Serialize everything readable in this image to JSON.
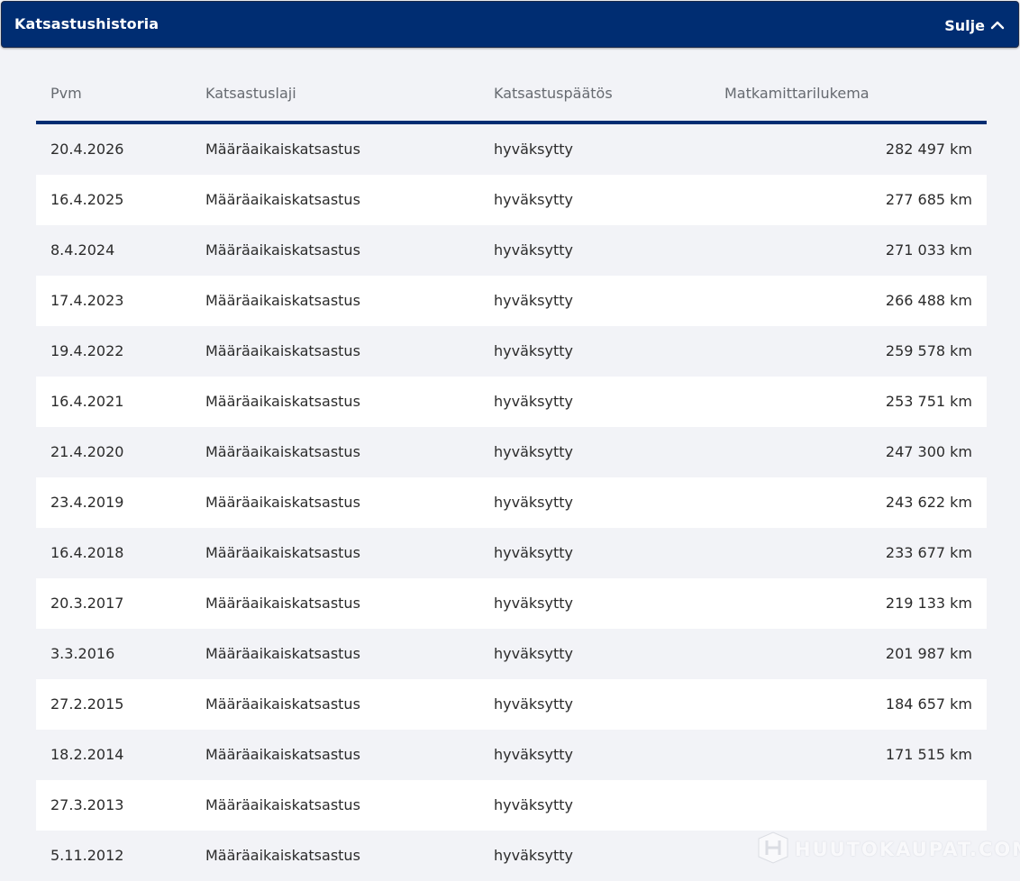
{
  "header": {
    "title": "Katsastushistoria",
    "close_label": "Sulje",
    "close_icon": "chevron-up-icon",
    "background": "#002d72"
  },
  "table": {
    "columns": [
      "Pvm",
      "Katsastuslaji",
      "Katsastuspäätös",
      "Matkamittarilukema"
    ],
    "rows": [
      {
        "date": "20.4.2026",
        "type": "Määräaikaiskatsastus",
        "decision": "hyväksytty",
        "odometer": "282 497 km"
      },
      {
        "date": "16.4.2025",
        "type": "Määräaikaiskatsastus",
        "decision": "hyväksytty",
        "odometer": "277 685 km"
      },
      {
        "date": "8.4.2024",
        "type": "Määräaikaiskatsastus",
        "decision": "hyväksytty",
        "odometer": "271 033 km"
      },
      {
        "date": "17.4.2023",
        "type": "Määräaikaiskatsastus",
        "decision": "hyväksytty",
        "odometer": "266 488 km"
      },
      {
        "date": "19.4.2022",
        "type": "Määräaikaiskatsastus",
        "decision": "hyväksytty",
        "odometer": "259 578 km"
      },
      {
        "date": "16.4.2021",
        "type": "Määräaikaiskatsastus",
        "decision": "hyväksytty",
        "odometer": "253 751 km"
      },
      {
        "date": "21.4.2020",
        "type": "Määräaikaiskatsastus",
        "decision": "hyväksytty",
        "odometer": "247 300 km"
      },
      {
        "date": "23.4.2019",
        "type": "Määräaikaiskatsastus",
        "decision": "hyväksytty",
        "odometer": "243 622 km"
      },
      {
        "date": "16.4.2018",
        "type": "Määräaikaiskatsastus",
        "decision": "hyväksytty",
        "odometer": "233 677 km"
      },
      {
        "date": "20.3.2017",
        "type": "Määräaikaiskatsastus",
        "decision": "hyväksytty",
        "odometer": "219 133 km"
      },
      {
        "date": "3.3.2016",
        "type": "Määräaikaiskatsastus",
        "decision": "hyväksytty",
        "odometer": "201 987 km"
      },
      {
        "date": "27.2.2015",
        "type": "Määräaikaiskatsastus",
        "decision": "hyväksytty",
        "odometer": "184 657 km"
      },
      {
        "date": "18.2.2014",
        "type": "Määräaikaiskatsastus",
        "decision": "hyväksytty",
        "odometer": "171 515 km"
      },
      {
        "date": "27.3.2013",
        "type": "Määräaikaiskatsastus",
        "decision": "hyväksytty",
        "odometer": ""
      },
      {
        "date": "5.11.2012",
        "type": "Määräaikaiskatsastus",
        "decision": "hyväksytty",
        "odometer": ""
      }
    ]
  },
  "watermark": {
    "text": "HUUTOKAUPAT.COM",
    "icon": "huutokaupat-logo-icon"
  }
}
